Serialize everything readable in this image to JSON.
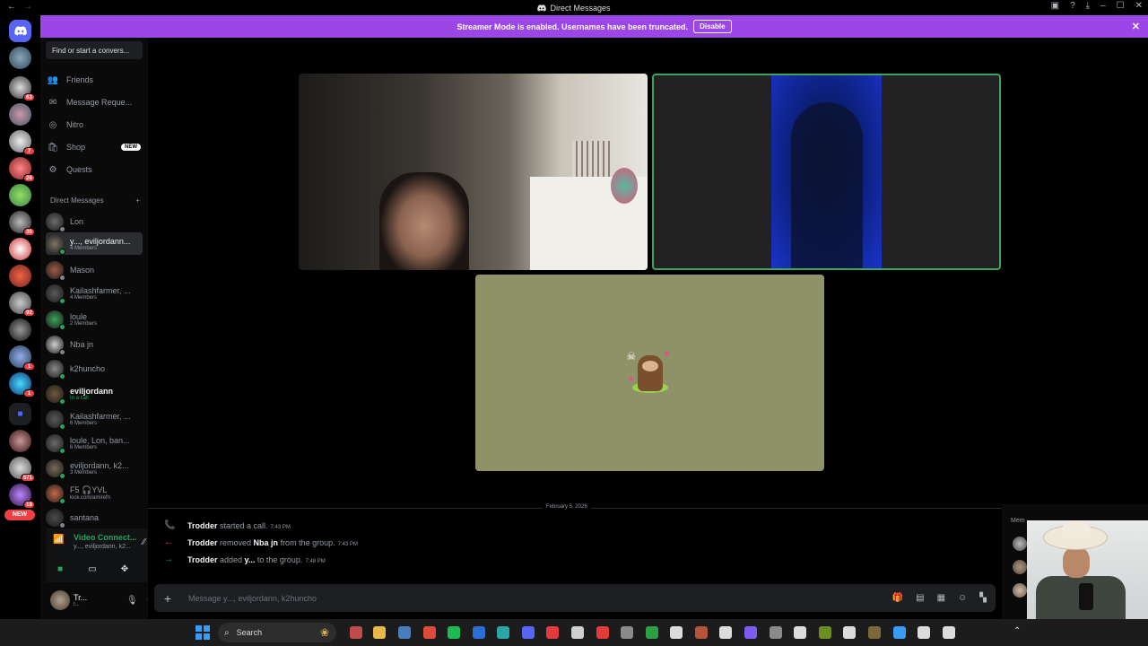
{
  "window": {
    "title": "Direct Messages",
    "back_icon": "←",
    "forward_icon": "→"
  },
  "banner": {
    "message": "Streamer Mode is enabled. Usernames have been truncated.",
    "disable_label": "Disable",
    "close_icon": "✕"
  },
  "servers": {
    "badges": [
      "63",
      "7",
      "26",
      "30",
      "92",
      "1",
      "1",
      "571",
      "18"
    ],
    "new_label": "NEW"
  },
  "dm_sidebar": {
    "search_placeholder": "Find or start a convers...",
    "nav": [
      {
        "label": "Friends",
        "icon": "friends-icon"
      },
      {
        "label": "Message Reque...",
        "icon": "envelope-icon"
      },
      {
        "label": "Nitro",
        "icon": "nitro-icon"
      },
      {
        "label": "Shop",
        "icon": "shop-icon",
        "tag": "NEW"
      },
      {
        "label": "Quests",
        "icon": "quests-icon"
      }
    ],
    "section_title": "Direct Messages",
    "add_icon": "+",
    "dms": [
      {
        "name": "Lon",
        "sub": "",
        "color": "#6b6b6b",
        "status": "off"
      },
      {
        "name": "y..., eviljordann...",
        "sub": "4 Members",
        "color": "#7d7466",
        "status": "on",
        "selected": true
      },
      {
        "name": "Mason",
        "sub": "",
        "color": "#a15a4a",
        "status": "off"
      },
      {
        "name": "Kailashfarmer, ...",
        "sub": "4 Members",
        "color": "#5a5a5a",
        "status": "on"
      },
      {
        "name": "loule",
        "sub": "2 Members",
        "color": "#3ba55d",
        "status": "on"
      },
      {
        "name": "Nba jn",
        "sub": "",
        "color": "#cfcfcf",
        "status": "off"
      },
      {
        "name": "k2huncho",
        "sub": "",
        "color": "#8a8a8a",
        "status": "on"
      },
      {
        "name": "eviljordann",
        "sub": "In a call",
        "color": "#6e5a3c",
        "status": "on",
        "bold": true,
        "green": true
      },
      {
        "name": "Kailashfarmer, ...",
        "sub": "6 Members",
        "color": "#5a5a5a",
        "status": "on"
      },
      {
        "name": "loule, Lon, ban...",
        "sub": "6 Members",
        "color": "#6a6a6a",
        "status": "on"
      },
      {
        "name": "eviljordann, k2...",
        "sub": "3 Members",
        "color": "#7a6a5a",
        "status": "on"
      },
      {
        "name": "F5 🎧YVL",
        "sub": "kick.com/amirefn",
        "color": "#c96a4a",
        "status": "on"
      },
      {
        "name": "santana",
        "sub": "",
        "color": "#4a4a4a",
        "status": "off"
      }
    ]
  },
  "voice": {
    "status": "Video Connect...",
    "channel": "y..., eviljordann, k2...",
    "user_name": "Tr...",
    "user_sub": "I..."
  },
  "chat": {
    "date_divider": "February 5, 2026",
    "messages": [
      {
        "icon": "call-icon",
        "icon_char": "📞",
        "icon_color": "#23a55a",
        "actor": "Trodder",
        "text_before": " started a call.",
        "target": "",
        "text_after": "",
        "time": "7:43 PM"
      },
      {
        "icon": "arrow-left-icon",
        "icon_char": "←",
        "icon_color": "#f23f43",
        "actor": "Trodder",
        "text_before": " removed ",
        "target": "Nba jn",
        "text_after": " from the group.",
        "time": "7:43 PM"
      },
      {
        "icon": "arrow-right-icon",
        "icon_char": "→",
        "icon_color": "#23a55a",
        "actor": "Trodder",
        "text_before": " added ",
        "target": "y...",
        "text_after": " to the group.",
        "time": "7:48 PM"
      }
    ],
    "composer_placeholder": "Message y..., eviljordann, k2huncho"
  },
  "members": {
    "label": "Mem"
  },
  "taskbar": {
    "search_label": "Search"
  }
}
